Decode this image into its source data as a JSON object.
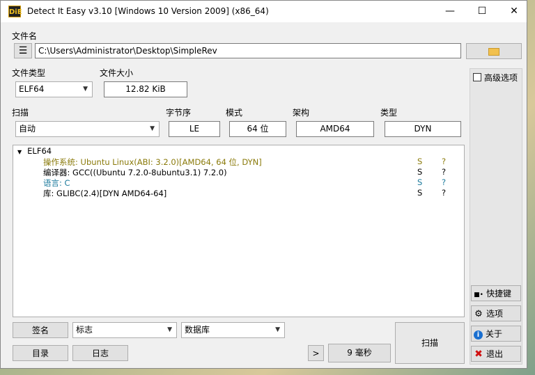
{
  "window": {
    "title": "Detect It Easy v3.10 [Windows 10 Version 2009] (x86_64)",
    "app_icon": "DiE"
  },
  "file": {
    "label": "文件名",
    "path": "C:\\Users\\Administrator\\Desktop\\SimpleRev"
  },
  "file_type": {
    "label": "文件类型",
    "value": "ELF64"
  },
  "file_size": {
    "label": "文件大小",
    "value": "12.82 KiB"
  },
  "scan": {
    "label": "扫描",
    "value": "自动"
  },
  "endian": {
    "label": "字节序",
    "value": "LE"
  },
  "mode": {
    "label": "模式",
    "value": "64 位"
  },
  "arch": {
    "label": "架构",
    "value": "AMD64"
  },
  "type": {
    "label": "类型",
    "value": "DYN"
  },
  "results": {
    "root": "ELF64",
    "rows": [
      {
        "text": "操作系统: Ubuntu Linux(ABI: 3.2.0)[AMD64, 64 位, DYN]",
        "s": "S",
        "q": "?"
      },
      {
        "text": "编译器: GCC((Ubuntu 7.2.0-8ubuntu3.1) 7.2.0)",
        "s": "S",
        "q": "?"
      },
      {
        "text": "语言: C",
        "s": "S",
        "q": "?"
      },
      {
        "text": "库: GLIBC(2.4)[DYN AMD64-64]",
        "s": "S",
        "q": "?"
      }
    ]
  },
  "advanced": {
    "label": "高级选项"
  },
  "side_buttons": {
    "shortcuts": "快捷键",
    "options": "选项",
    "about": "关于",
    "exit": "退出"
  },
  "bottom": {
    "signatures": "签名",
    "flags": "标志",
    "database": "数据库",
    "directory": "目录",
    "log": "日志",
    "next": ">",
    "time": "9 毫秒",
    "scan_button": "扫描"
  },
  "colors": {
    "os_text": "#8a7a0a",
    "lang_text": "#1c7a9c",
    "exit_icon": "#d01010",
    "about_icon": "#1a6fd0"
  }
}
